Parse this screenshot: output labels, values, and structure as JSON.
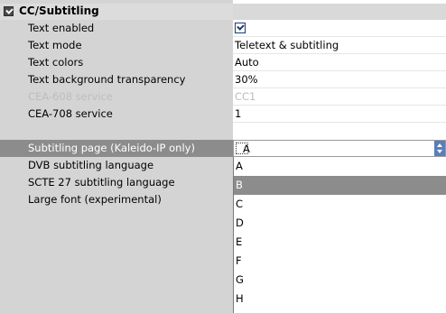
{
  "section": {
    "title": "CC/Subtitling"
  },
  "rows": [
    {
      "label": "Text enabled",
      "value": "",
      "checked": true
    },
    {
      "label": "Text mode",
      "value": "Teletext & subtitling"
    },
    {
      "label": "Text colors",
      "value": "Auto"
    },
    {
      "label": "Text background transparency",
      "value": "30%"
    },
    {
      "label": "CEA-608 service",
      "value": "CC1",
      "disabled": true
    },
    {
      "label": "CEA-708 service",
      "value": "1"
    },
    {
      "label": "Subtitling page (Kaleido-IP only)",
      "value": "A"
    },
    {
      "label": "DVB subtitling language",
      "value": ""
    },
    {
      "label": "SCTE 27 subtitling language",
      "value": ""
    },
    {
      "label": "Large font (experimental)",
      "value": ""
    }
  ],
  "dropdown": {
    "options": [
      "A",
      "B",
      "C",
      "D",
      "E",
      "F",
      "G",
      "H"
    ],
    "selected": "B"
  },
  "colors": {
    "label_bg": "#d4d4d4",
    "highlight": "#8c8c8c",
    "accent": "#5a7fb8"
  }
}
